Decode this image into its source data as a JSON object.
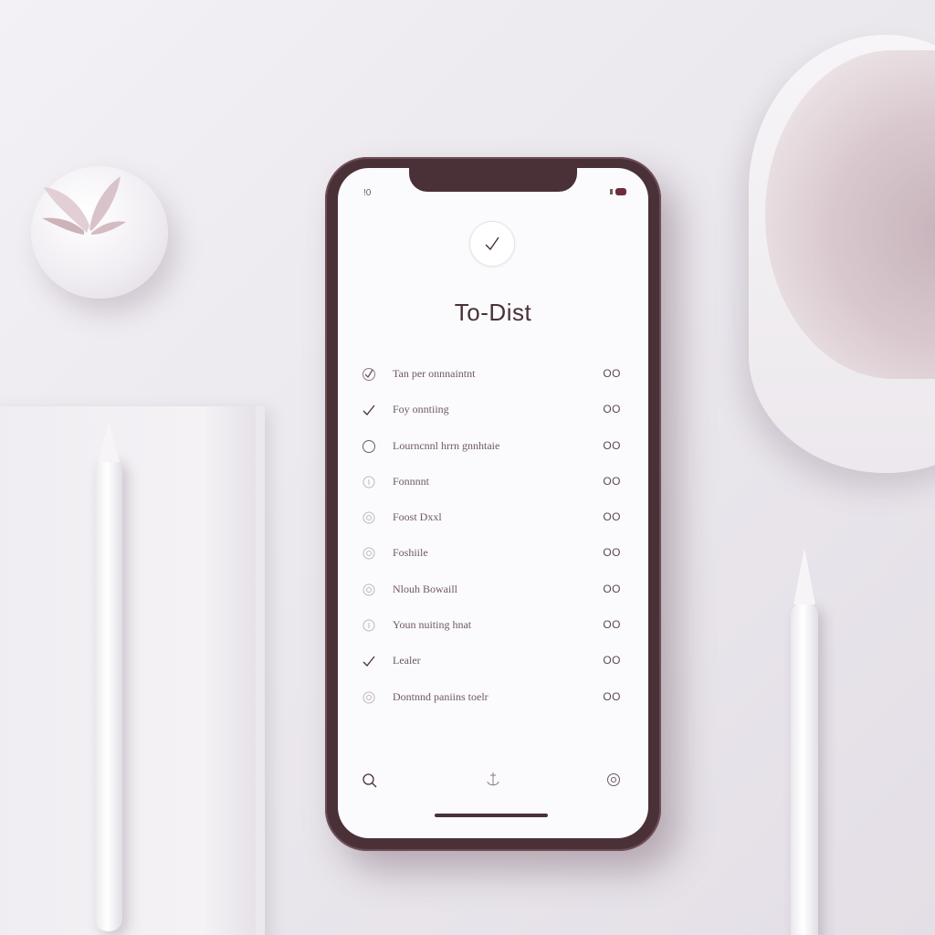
{
  "app": {
    "title": "To-Dist",
    "status_left": "!0"
  },
  "tasks": [
    {
      "label": "Tan per onnnaintnt",
      "state": "checked-circle",
      "value": "OO"
    },
    {
      "label": "Foy onntiing",
      "state": "checked",
      "value": "OO"
    },
    {
      "label": "Lourncnnl hrrn gnnhtaie",
      "state": "open",
      "value": "OO"
    },
    {
      "label": "Fonnnnt",
      "state": "faint",
      "value": "OO"
    },
    {
      "label": "Foost Dxxl",
      "state": "faint",
      "value": "OO"
    },
    {
      "label": "Foshiile",
      "state": "faint",
      "value": "OO"
    },
    {
      "label": "Nlouh Bowaill",
      "state": "faint",
      "value": "OO"
    },
    {
      "label": "Youn nuiting hnat",
      "state": "faint",
      "value": "OO"
    },
    {
      "label": "Lealer",
      "state": "checked",
      "value": "OO"
    },
    {
      "label": "Dontnnd paniins toelr",
      "state": "faint",
      "value": "OO"
    }
  ],
  "tab_bar": {
    "items": [
      "search-icon",
      "anchor-icon",
      "settings-icon"
    ]
  },
  "colors": {
    "phone_frame": "#4a3137",
    "screen": "#fbfafc",
    "text": "#6e5a60",
    "accent": "#6e2d3a"
  }
}
